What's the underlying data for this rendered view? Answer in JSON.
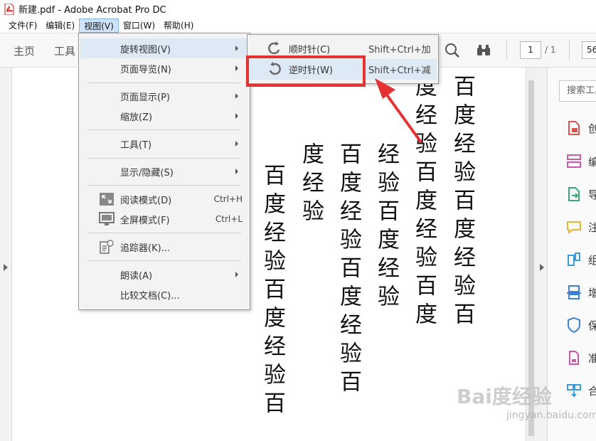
{
  "window": {
    "title": "新建.pdf - Adobe Acrobat Pro DC",
    "icon": "pdf-file-icon"
  },
  "menubar": {
    "items": [
      "文件(F)",
      "编辑(E)",
      "视图(V)",
      "窗口(W)",
      "帮助(H)"
    ],
    "active": "视图(V)"
  },
  "toolbar": {
    "home_tab": "主页",
    "tools_tab": "工具",
    "search_icon": "magnifier-icon",
    "find_icon": "binoculars-icon",
    "page_current": "1",
    "page_total": "/ 1",
    "zoom": "56"
  },
  "view_menu": {
    "items": [
      {
        "label": "旋转视图(V)",
        "submenu": true,
        "highlighted": true
      },
      {
        "label": "页面导览(N)",
        "submenu": true
      },
      {
        "label": "页面显示(P)",
        "submenu": true
      },
      {
        "label": "缩放(Z)",
        "submenu": true
      },
      {
        "label": "工具(T)",
        "submenu": true
      },
      {
        "label": "显示/隐藏(S)",
        "submenu": true
      },
      {
        "label": "阅读模式(D)",
        "shortcut": "Ctrl+H",
        "icon": "reading-mode-icon"
      },
      {
        "label": "全屏模式(F)",
        "shortcut": "Ctrl+L",
        "icon": "fullscreen-icon"
      },
      {
        "label": "追踪器(K)...",
        "icon": "tracker-icon"
      },
      {
        "label": "朗读(A)",
        "submenu": true
      },
      {
        "label": "比较文档(C)..."
      }
    ]
  },
  "rotate_submenu": {
    "items": [
      {
        "label": "顺时针(C)",
        "shortcut": "Shift+Ctrl+加",
        "icon": "rotate-clockwise-icon"
      },
      {
        "label": "逆时针(W)",
        "shortcut": "Shift+Ctrl+减",
        "icon": "rotate-counterclockwise-icon",
        "highlighted": true
      }
    ]
  },
  "document": {
    "columns": [
      "百度经验百度经验百",
      "度经验百度经验百度",
      "经验百度经验",
      "百度经验百度经验百",
      "度经验",
      "百度经验百度经验百"
    ]
  },
  "right_panel": {
    "search_placeholder": "搜索工具",
    "tools": [
      {
        "label": "创",
        "icon": "create-pdf-icon",
        "color": "#d9534f"
      },
      {
        "label": "编",
        "icon": "edit-pdf-icon",
        "color": "#c85aa8"
      },
      {
        "label": "导",
        "icon": "export-pdf-icon",
        "color": "#3aa776"
      },
      {
        "label": "注",
        "icon": "comment-icon",
        "color": "#e8b530"
      },
      {
        "label": "组",
        "icon": "organize-pages-icon",
        "color": "#3b9ad9"
      },
      {
        "label": "增",
        "icon": "enhance-scan-icon",
        "color": "#3b7fd9"
      },
      {
        "label": "保",
        "icon": "protect-shield-icon",
        "color": "#3b7fd9"
      },
      {
        "label": "准",
        "icon": "prepare-form-icon",
        "color": "#c85aa8"
      },
      {
        "label": "合",
        "icon": "combine-files-icon",
        "color": "#3b9ad9"
      }
    ]
  },
  "watermark": {
    "logo": "Bai度经验",
    "sub": "jingyan.baidu.com"
  },
  "colors": {
    "menu_highlight": "#dde9f5",
    "annotation_red": "#e53333"
  }
}
